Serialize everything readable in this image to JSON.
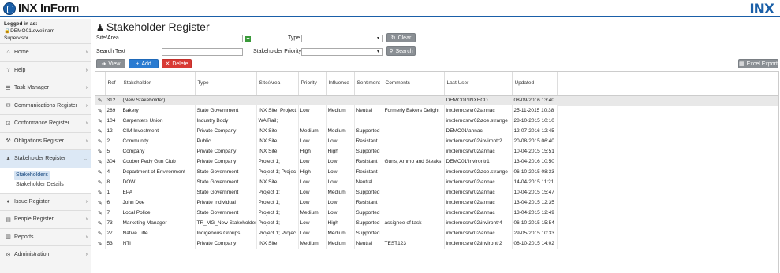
{
  "header": {
    "app_title": "INX InForm",
    "brand": "INX"
  },
  "sidebar": {
    "login_label": "Logged in as:",
    "user": "DEMO01\\ewelinam",
    "role": "Supervisor",
    "items": [
      {
        "label": "Home",
        "icon": "home-icon",
        "glyph": "⌂"
      },
      {
        "label": "Help",
        "icon": "help-icon",
        "glyph": "?"
      },
      {
        "label": "Task Manager",
        "icon": "tasks-icon",
        "glyph": "☰"
      },
      {
        "label": "Communications Register",
        "icon": "comments-icon",
        "glyph": "✉"
      },
      {
        "label": "Conformance Register",
        "icon": "check-icon",
        "glyph": "☑"
      },
      {
        "label": "Obligations Register",
        "icon": "gavel-icon",
        "glyph": "⚒"
      },
      {
        "label": "Stakeholder Register",
        "icon": "users-icon",
        "glyph": "♟"
      },
      {
        "label": "Issue Register",
        "icon": "issue-icon",
        "glyph": "●"
      },
      {
        "label": "People Register",
        "icon": "id-card-icon",
        "glyph": "▤"
      },
      {
        "label": "Reports",
        "icon": "chart-icon",
        "glyph": "▥"
      },
      {
        "label": "Administration",
        "icon": "gear-icon",
        "glyph": "⚙"
      }
    ],
    "subitems": [
      "Stakeholders",
      "Stakeholder Details"
    ]
  },
  "page": {
    "title": "Stakeholder Register",
    "filters": {
      "site_area_label": "Site/Area",
      "search_text_label": "Search Text",
      "type_label": "Type",
      "priority_label": "Stakeholder Priority",
      "site_area_value": "",
      "search_text_value": "",
      "type_value": "",
      "priority_value": ""
    },
    "buttons": {
      "clear": "Clear",
      "search": "Search",
      "view": "View",
      "add": "Add",
      "delete": "Delete",
      "excel": "Excel Export"
    }
  },
  "table": {
    "columns": [
      "Ref",
      "Stakeholder",
      "Type",
      "Site/Area",
      "Priority",
      "Influence",
      "Sentiment",
      "Comments",
      "Last User",
      "Updated"
    ],
    "rows": [
      [
        "312",
        "(New Stakeholder)",
        "",
        "",
        "",
        "",
        "",
        "",
        "DEMO01\\INXECD",
        "08-09-2016 13:40"
      ],
      [
        "289",
        "Bakery",
        "State Government",
        "INX Site; Project",
        "Low",
        "Medium",
        "Neutral",
        "Formerly Bakers Delight",
        "inxdemosrvr02\\annac",
        "25-11-2015 10:38"
      ],
      [
        "104",
        "Carpenters Union",
        "Industry Body",
        "WA Rail;",
        "",
        "",
        "",
        "",
        "inxdemosrvr02\\zoe.strange",
        "28-10-2015 10:10"
      ],
      [
        "12",
        "CIM Investment",
        "Private Company",
        "INX Site;",
        "Medium",
        "Medium",
        "Supported",
        "",
        "DEMO01\\annac",
        "12-07-2016 12:45"
      ],
      [
        "2",
        "Community",
        "Public",
        "INX Site;",
        "Low",
        "Low",
        "Resistant",
        "",
        "inxdemosrvr02\\invirontr2",
        "20-08-2015 06:40"
      ],
      [
        "5",
        "Company",
        "Private Company",
        "INX Site;",
        "High",
        "High",
        "Supported",
        "",
        "inxdemosrvr02\\annac",
        "10-04-2015 15:51"
      ],
      [
        "304",
        "Coober Pedy Gun Club",
        "Private Company",
        "Project 1;",
        "Low",
        "Low",
        "Resistant",
        "Guns, Ammo and Steaks",
        "DEMO01\\invirontr1",
        "13-04-2016 10:50"
      ],
      [
        "4",
        "Department of Environment",
        "State Government",
        "Project 1; Projec",
        "High",
        "Low",
        "Resistant",
        "",
        "inxdemosrvr02\\zoe.strange",
        "06-10-2015 08:33"
      ],
      [
        "8",
        "DOW",
        "State Government",
        "INX Site;",
        "Low",
        "Low",
        "Neutral",
        "",
        "inxdemosrvr02\\annac",
        "14-04-2015 11:21"
      ],
      [
        "1",
        "EPA",
        "State Government",
        "Project 1;",
        "Low",
        "Medium",
        "Supported",
        "",
        "inxdemosrvr02\\annac",
        "10-04-2015 15:47"
      ],
      [
        "6",
        "John Doe",
        "Private Individual",
        "Project 1;",
        "Low",
        "Low",
        "Resistant",
        "",
        "inxdemosrvr02\\annac",
        "13-04-2015 12:35"
      ],
      [
        "7",
        "Local Police",
        "State Government",
        "Project 1;",
        "Medium",
        "Low",
        "Supported",
        "",
        "inxdemosrvr02\\annac",
        "13-04-2015 12:49"
      ],
      [
        "73",
        "Marketing Manager",
        "TR_MG_New Stakeholder",
        "Project 1;",
        "Low",
        "High",
        "Supported",
        "assignee of task",
        "inxdemosrvr02\\invirontr4",
        "06-10-2015 15:54"
      ],
      [
        "27",
        "Native Title",
        "Indigenous Groups",
        "Project 1; Projec",
        "Low",
        "Medium",
        "Supported",
        "",
        "inxdemosrvr02\\annac",
        "29-05-2015 10:33"
      ],
      [
        "53",
        "NTI",
        "Private Company",
        "INX Site;",
        "Medium",
        "Medium",
        "Neutral",
        "TEST123",
        "inxdemosrvr02\\invirontr2",
        "06-10-2015 14:02"
      ]
    ]
  },
  "colors": {
    "accent": "#1a5fa8",
    "add_button": "#2a7bd1",
    "delete_button": "#d83a34",
    "neutral_button": "#8a8f94",
    "selected_row": "#e8e8e8"
  }
}
